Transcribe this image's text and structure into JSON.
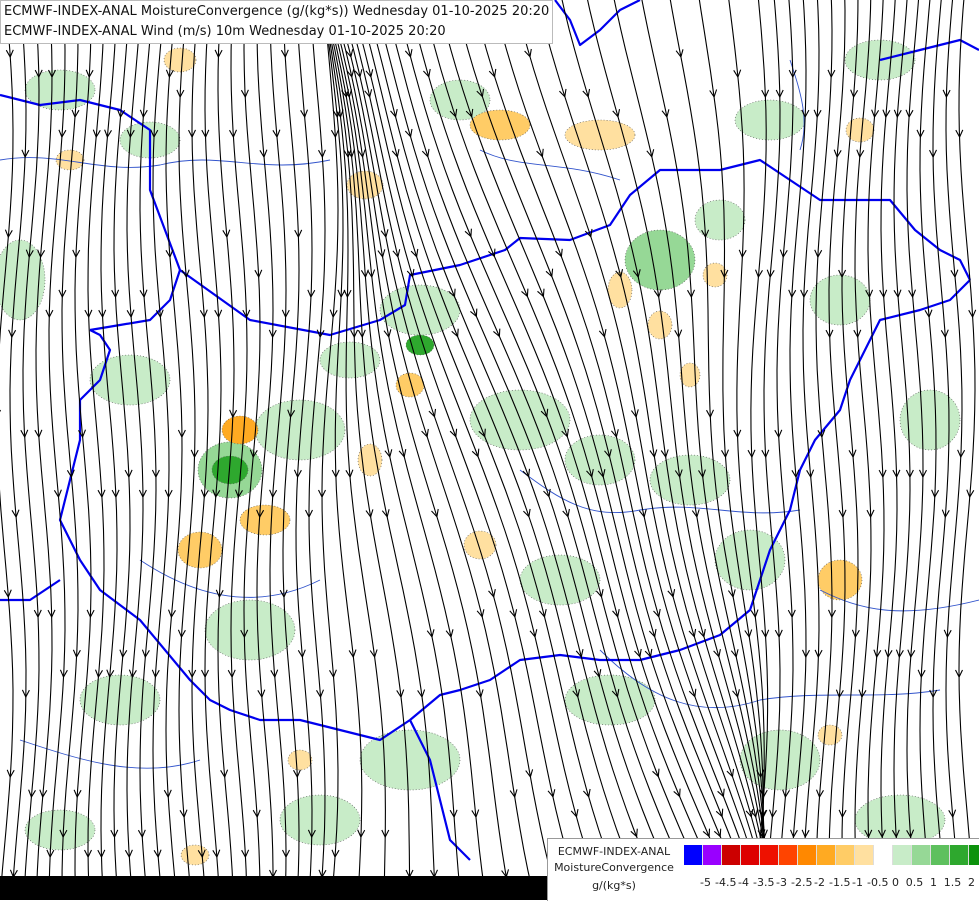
{
  "titles": {
    "line1": "ECMWF-INDEX-ANAL MoistureConvergence (g/(kg*s)) Wednesday 01-10-2025 20:20",
    "line2": "ECMWF-INDEX-ANAL Wind (m/s) 10m Wednesday 01-10-2025 20:20"
  },
  "legend": {
    "source": "ECMWF-INDEX-ANAL",
    "parameter": "MoistureConvergence",
    "unit": "g/(kg*s)",
    "colors": [
      "#0000ff",
      "#9900ff",
      "#cc0000",
      "#dd0000",
      "#ee1100",
      "#ff4400",
      "#ff8800",
      "#ffaa22",
      "#ffcc66",
      "#ffe0a0",
      "#ffffff",
      "#c8ecc8",
      "#96d896",
      "#5ec05e",
      "#2ea82e",
      "#0c920c"
    ],
    "ticks": [
      "-5",
      "-4.5",
      "-4",
      "-3.5",
      "-3",
      "-2.5",
      "-2",
      "-1.5",
      "-1",
      "-0.5",
      "0",
      "0.5",
      "1",
      "1.5",
      "2"
    ]
  },
  "colors": {
    "border": "#0000ee",
    "river": "#3355cc",
    "streamline": "#000000",
    "convergence_light": "#c8ecc8",
    "convergence_mid": "#96d896",
    "convergence_strong": "#2ea82e",
    "divergence_light": "#ffe0a0",
    "divergence_mid": "#ffcc66",
    "divergence_strong": "#ffaa22"
  }
}
